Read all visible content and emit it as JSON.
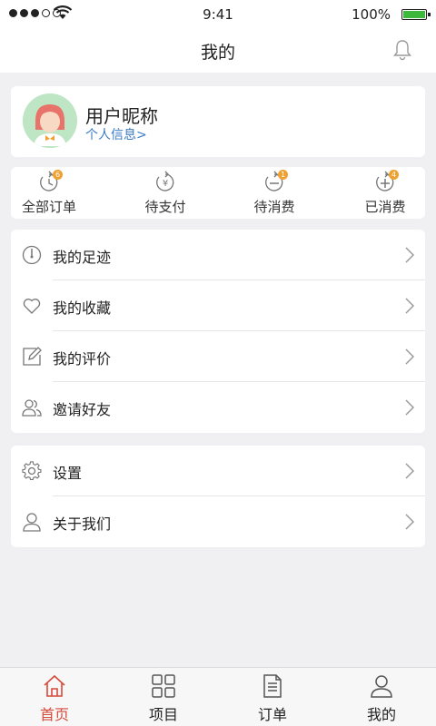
{
  "status_bar": {
    "time": "9:41",
    "battery": "100%"
  },
  "nav": {
    "title": "我的"
  },
  "profile": {
    "nickname": "用户昵称",
    "info_link": "个人信息>"
  },
  "orders": [
    {
      "label": "全部订单",
      "icon": "clock-rewind-icon",
      "badge": "6"
    },
    {
      "label": "待支付",
      "icon": "yen-circle-icon",
      "badge": ""
    },
    {
      "label": "待消费",
      "icon": "minus-circle-icon",
      "badge": "1"
    },
    {
      "label": "已消费",
      "icon": "plus-circle-icon",
      "badge": "4"
    }
  ],
  "menu_group_1": [
    {
      "label": "我的足迹",
      "icon": "gauge-icon"
    },
    {
      "label": "我的收藏",
      "icon": "heart-icon"
    },
    {
      "label": "我的评价",
      "icon": "edit-icon"
    },
    {
      "label": "邀请好友",
      "icon": "friends-icon"
    }
  ],
  "menu_group_2": [
    {
      "label": "设置",
      "icon": "gear-icon"
    },
    {
      "label": "关于我们",
      "icon": "user-icon"
    }
  ],
  "tabbar": [
    {
      "label": "首页",
      "icon": "home-icon",
      "active": true
    },
    {
      "label": "项目",
      "icon": "grid-icon",
      "active": false
    },
    {
      "label": "订单",
      "icon": "document-icon",
      "active": false
    },
    {
      "label": "我的",
      "icon": "person-icon",
      "active": false
    }
  ],
  "colors": {
    "accent": "#d64a3a",
    "link": "#3b7bc4",
    "badge": "#f0a030",
    "battery": "#3cb83c"
  }
}
